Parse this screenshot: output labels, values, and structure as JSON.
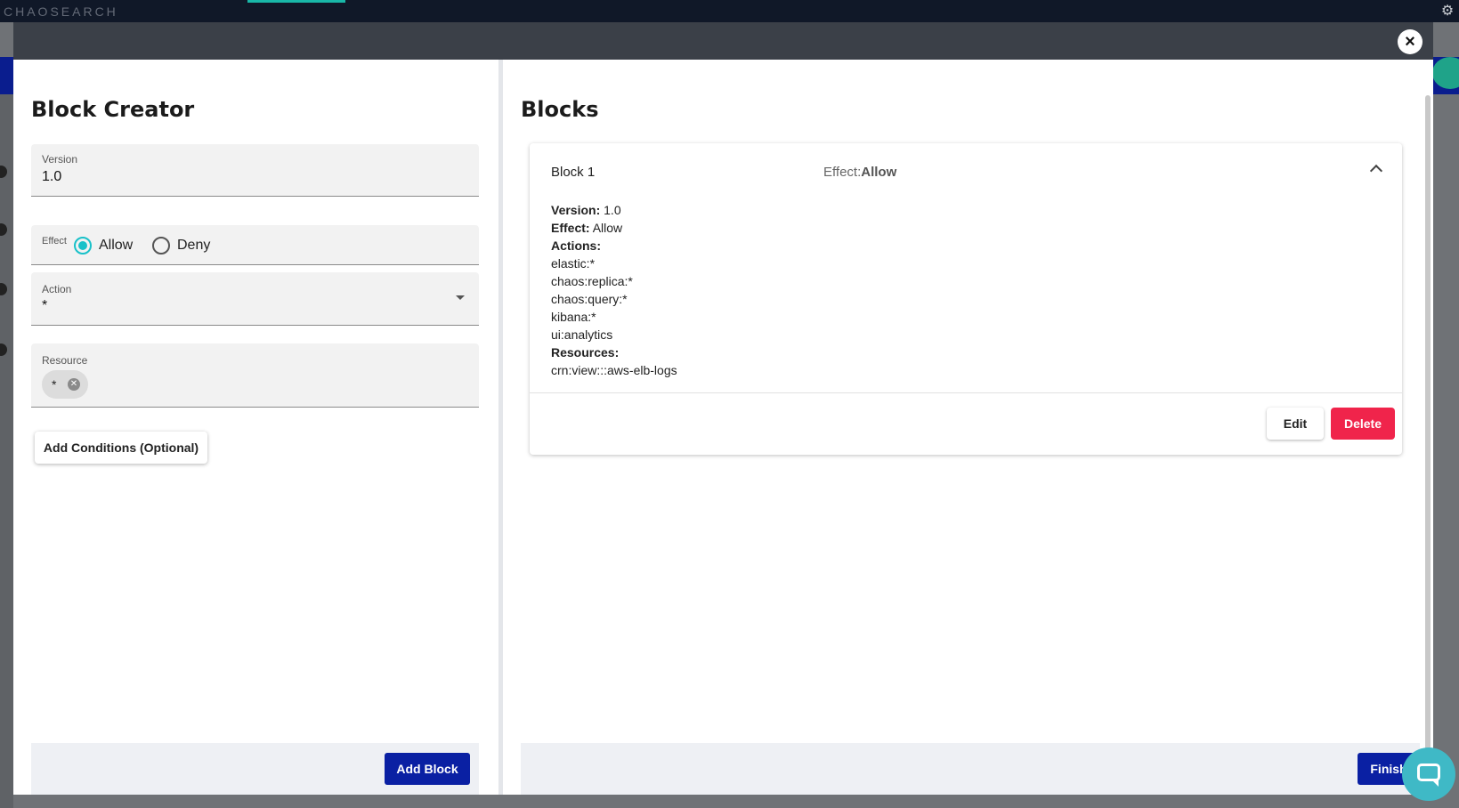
{
  "background": {
    "app_title": "CHAOSEARCH"
  },
  "modal": {
    "close_label": "×"
  },
  "block_creator": {
    "title": "Block Creator",
    "version": {
      "label": "Version",
      "value": "1.0"
    },
    "effect": {
      "label": "Effect",
      "options": [
        {
          "label": "Allow",
          "selected": true
        },
        {
          "label": "Deny",
          "selected": false
        }
      ]
    },
    "action": {
      "label": "Action",
      "value": "*"
    },
    "resource": {
      "label": "Resource",
      "chips": [
        "*"
      ]
    },
    "add_conditions_label": "Add Conditions (Optional)",
    "add_block_label": "Add Block"
  },
  "blocks": {
    "title": "Blocks",
    "items": [
      {
        "name": "Block 1",
        "effect_prefix": "Effect:",
        "effect_value": "Allow",
        "details": {
          "version_label": "Version:",
          "version_value": "1.0",
          "effect_label": "Effect:",
          "effect_value": "Allow",
          "actions_label": "Actions:",
          "actions": [
            "elastic:*",
            "chaos:replica:*",
            "chaos:query:*",
            "kibana:*",
            "ui:analytics"
          ],
          "resources_label": "Resources:",
          "resources": [
            "crn:view:::aws-elb-logs"
          ]
        },
        "edit_label": "Edit",
        "delete_label": "Delete"
      }
    ],
    "finish_label": "Finish"
  },
  "colors": {
    "primary": "#0a20a3",
    "danger": "#f0244b",
    "radio_accent": "#19c1c9",
    "chat": "#3fb9c6"
  }
}
